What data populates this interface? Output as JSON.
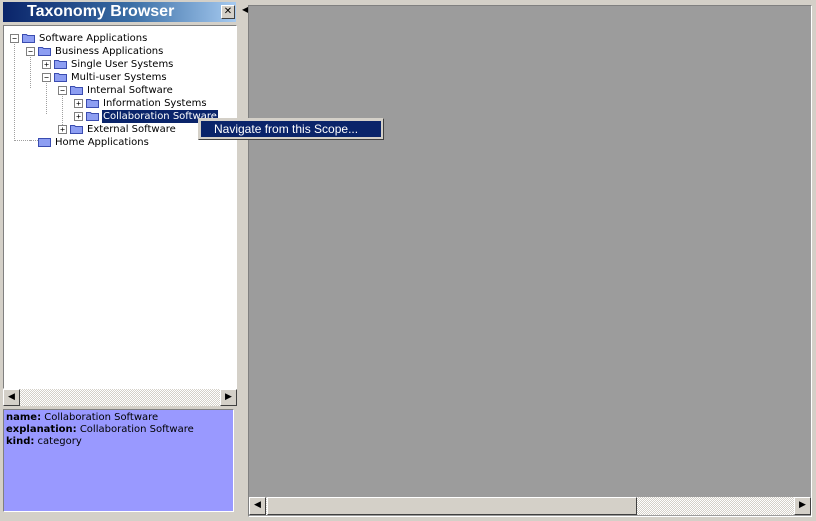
{
  "panel": {
    "title": "Taxonomy Browser",
    "close_glyph": "✕"
  },
  "tree": {
    "items": [
      {
        "label": "Software Applications",
        "expander": "−"
      },
      {
        "label": "Business Applications",
        "expander": "−"
      },
      {
        "label": "Single User Systems",
        "expander": "+"
      },
      {
        "label": "Multi-user Systems",
        "expander": "−"
      },
      {
        "label": "Internal Software",
        "expander": "−"
      },
      {
        "label": "Information Systems",
        "expander": "+"
      },
      {
        "label": "Collaboration Software",
        "expander": "+"
      },
      {
        "label": "External Software",
        "expander": "+"
      },
      {
        "label": "Home Applications",
        "expander": ""
      }
    ],
    "selected": "Collaboration Software"
  },
  "scroll": {
    "left_arrow": "◀",
    "right_arrow": "▶",
    "collapse_arrow": "◀"
  },
  "info": {
    "name_key": "name:",
    "name_value": "Collaboration Software",
    "explanation_key": "explanation:",
    "explanation_value": "Collaboration Software",
    "kind_key": "kind:",
    "kind_value": "category",
    "background_color": "#9999ff"
  },
  "context_menu": {
    "item": "Navigate from this Scope..."
  },
  "colors": {
    "selection": "#0a246a",
    "canvas": "#9c9c9c",
    "chrome": "#d4d0c8"
  },
  "icons": {
    "folder": "folder-icon",
    "close": "close-icon",
    "expand": "plus-box-icon",
    "collapse": "minus-box-icon"
  }
}
